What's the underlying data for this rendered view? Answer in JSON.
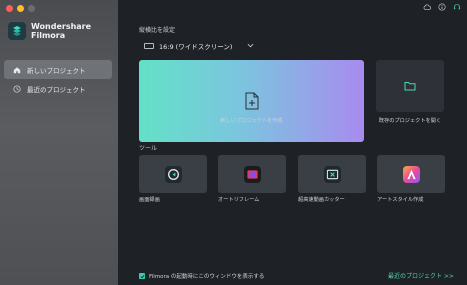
{
  "app": {
    "logo_text_line1": "Wondershare",
    "logo_text_line2": "Filmora"
  },
  "sidebar": {
    "items": [
      {
        "label": "新しいプロジェクト",
        "icon": "home-icon",
        "active": true
      },
      {
        "label": "最近のプロジェクト",
        "icon": "clock-icon",
        "active": false
      }
    ]
  },
  "header": {
    "icons": [
      "cloud-icon",
      "info-icon",
      "headset-icon"
    ]
  },
  "aspect": {
    "section_label": "縦横比を設定",
    "selected": "16:9 (ワイドスクリーン)"
  },
  "projects": {
    "new_label": "新しいプロジェクトを作成",
    "open_label": "既存のプロジェクトを開く"
  },
  "tools": {
    "section_label": "ツール",
    "items": [
      {
        "label": "画面録画",
        "icon": "screen-record-icon"
      },
      {
        "label": "オートリフレーム",
        "icon": "auto-reframe-icon"
      },
      {
        "label": "超高速動画カッター",
        "icon": "video-cutter-icon"
      },
      {
        "label": "アートスタイル作成",
        "icon": "art-style-icon"
      }
    ]
  },
  "footer": {
    "checkbox_label": "Filmora の起動時にこのウィンドウを表示する",
    "checkbox_checked": true,
    "recent_link": "最近のプロジェクト >>"
  },
  "colors": {
    "accent": "#4fd6b3",
    "main_bg": "#1e2126",
    "sidebar_active": "#6f7276"
  }
}
